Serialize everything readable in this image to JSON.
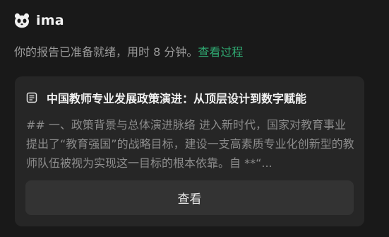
{
  "app": {
    "name": "ima",
    "logo_icon": "panda-icon"
  },
  "status": {
    "message": "你的报告已准备就绪，用时 8 分钟。",
    "link_label": "查看过程",
    "link_color": "#2fa871"
  },
  "report_card": {
    "icon": "document-icon",
    "title": "中国教师专业发展政策演进：从顶层设计到数字赋能",
    "excerpt": "## 一、政策背景与总体演进脉络 进入新时代，国家对教育事业提出了“教育强国”的战略目标，建设一支高素质专业化创新型的教师队伍被视为实现这一目标的根本依靠。自 **“...",
    "view_button_label": "查看"
  },
  "colors": {
    "background": "#191919",
    "card": "#262626",
    "button": "#333333"
  }
}
